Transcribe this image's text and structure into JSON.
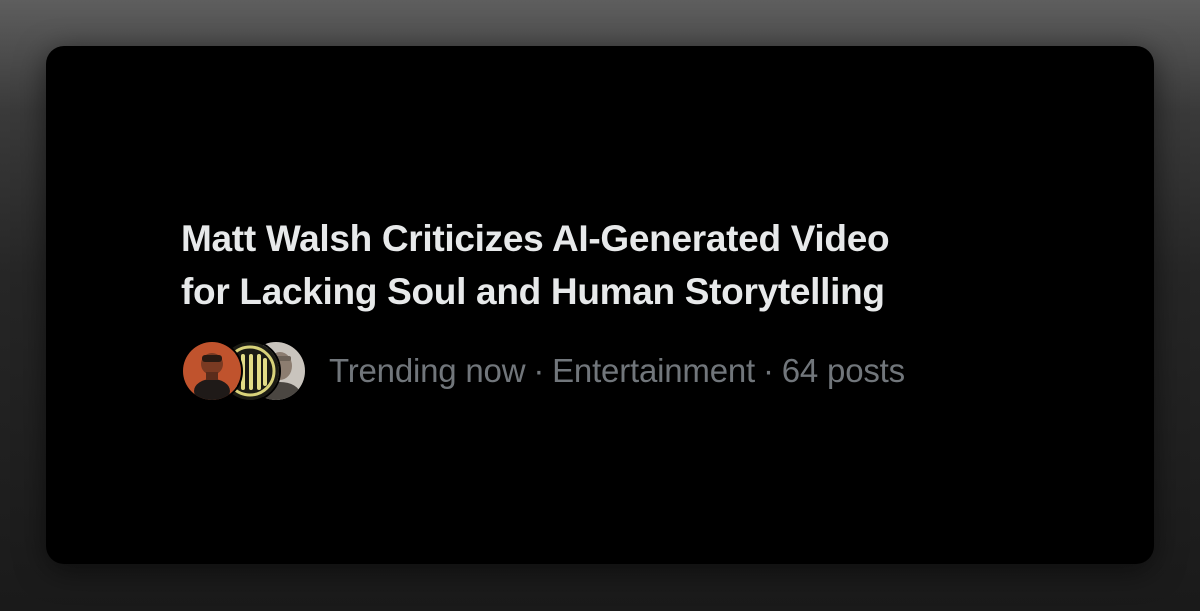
{
  "trend": {
    "headline_line1": "Matt Walsh Criticizes AI-Generated Video",
    "headline_line2": "for Lacking Soul and Human Storytelling",
    "status": "Trending now",
    "separator": "·",
    "category": "Entertainment",
    "post_count": "64 posts"
  },
  "avatars": [
    {
      "icon": "user-avatar-photo",
      "bg": "#c0532d"
    },
    {
      "icon": "user-avatar-logo",
      "bg": "#1b1b14"
    },
    {
      "icon": "user-avatar-photo",
      "bg": "#b9b4ad"
    }
  ],
  "colors": {
    "card_bg": "#000000",
    "headline": "#e7e9ea",
    "meta": "#71767b"
  }
}
